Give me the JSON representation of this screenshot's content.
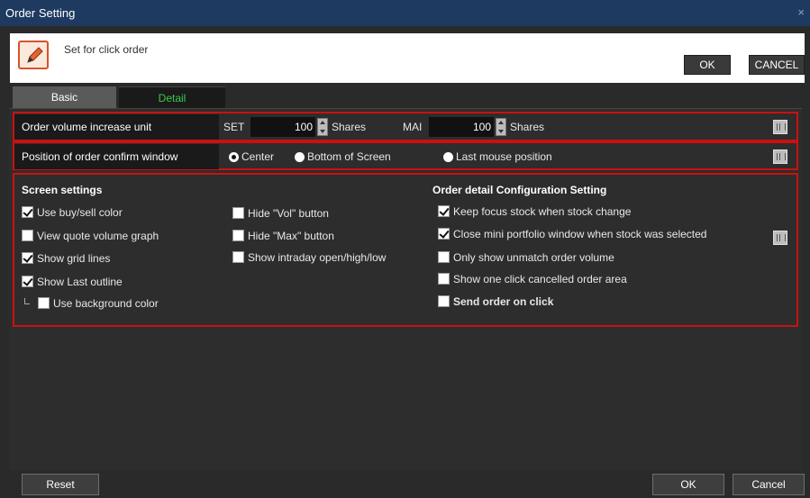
{
  "window": {
    "title": "Order Setting",
    "close_glyph": "×"
  },
  "header": {
    "subtitle": "Set for click order",
    "ok_label": "OK",
    "cancel_label": "CANCEL",
    "icon": "edit-icon"
  },
  "tabs": [
    {
      "label": "Basic",
      "active": false
    },
    {
      "label": "Detail",
      "active": true
    }
  ],
  "volume_row": {
    "label": "Order volume increase unit",
    "set_label": "SET",
    "set_value": "100",
    "set_unit": "Shares",
    "mai_label": "MAI",
    "mai_value": "100",
    "mai_unit": "Shares"
  },
  "position_row": {
    "label": "Position of order confirm window",
    "options": [
      {
        "label": "Center",
        "selected": true
      },
      {
        "label": "Bottom of Screen",
        "selected": false
      },
      {
        "label": "Last mouse position",
        "selected": false
      }
    ]
  },
  "screen_settings": {
    "title": "Screen settings",
    "col1": [
      {
        "label": "Use buy/sell color",
        "checked": true
      },
      {
        "label": "View quote volume graph",
        "checked": false
      },
      {
        "label": "Show grid lines",
        "checked": true
      },
      {
        "label": "Show Last outline",
        "checked": true
      },
      {
        "label": "Use background color",
        "checked": false
      }
    ],
    "col2": [
      {
        "label": "Hide \"Vol\" button",
        "checked": false
      },
      {
        "label": "Hide \"Max\" button",
        "checked": false
      },
      {
        "label": "Show intraday open/high/low",
        "checked": false
      }
    ]
  },
  "order_detail": {
    "title": "Order detail Configuration Setting",
    "items": [
      {
        "label": "Keep focus stock when stock change",
        "checked": true
      },
      {
        "label": "Close mini portfolio window when stock was selected",
        "checked": true
      },
      {
        "label": "Only show unmatch order volume",
        "checked": false
      },
      {
        "label": "Show one click cancelled order area",
        "checked": false
      },
      {
        "label": "Send order on click",
        "checked": false
      }
    ]
  },
  "footer": {
    "reset_label": "Reset",
    "ok_label": "OK",
    "cancel_label": "Cancel"
  },
  "colors": {
    "titlebar": "#1f3a60",
    "highlight_border": "#cc1010",
    "active_tab_text": "#3cc84c"
  }
}
